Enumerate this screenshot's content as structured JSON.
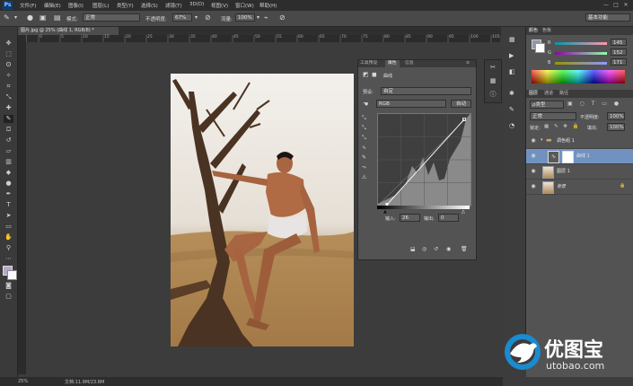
{
  "app": {
    "logo": "Ps",
    "workspace": "基本功能"
  },
  "menu": [
    "文件(F)",
    "编辑(E)",
    "图像(I)",
    "图层(L)",
    "类型(Y)",
    "选择(S)",
    "滤镜(T)",
    "3D(D)",
    "视图(V)",
    "窗口(W)",
    "帮助(H)"
  ],
  "window_controls": [
    "—",
    "□",
    "✕"
  ],
  "options": {
    "mode_label": "模式:",
    "mode_value": "正常",
    "opacity_label": "不透明度:",
    "opacity_value": "67%",
    "flow_label": "流量:",
    "flow_value": "100%"
  },
  "document": {
    "tab_title": "图片.jpg @ 25% (曲线 1, RGB/8) *",
    "zoom": "25%",
    "doc_info": "文档:11.9M/23.8M",
    "ruler_ticks": [
      "0",
      "5",
      "10",
      "15",
      "20",
      "25",
      "30",
      "35",
      "40",
      "45",
      "50",
      "55",
      "60",
      "65",
      "70",
      "75",
      "80",
      "85",
      "90",
      "95",
      "100",
      "105"
    ]
  },
  "properties": {
    "tabs": [
      "工具预设",
      "属性",
      "信息"
    ],
    "title": "曲线",
    "preset_label": "预设:",
    "preset_value": "自定",
    "channel_value": "RGB",
    "auto_button": "自动",
    "input_label": "输入:",
    "input_value": "26",
    "output_label": "输出:",
    "output_value": "0"
  },
  "color_panel": {
    "tabs": [
      "颜色",
      "色板"
    ],
    "r_label": "R",
    "r_value": "145",
    "g_label": "G",
    "g_value": "152",
    "b_label": "B",
    "b_value": "171"
  },
  "layers_panel": {
    "tabs": [
      "图层",
      "通道",
      "路径"
    ],
    "filter_value": "ρ类型",
    "blend_value": "正常",
    "opacity_label": "不透明度:",
    "opacity_value": "100%",
    "lock_label": "锁定:",
    "fill_label": "填充:",
    "fill_value": "100%",
    "layers": [
      {
        "name": "调色组 1",
        "type": "group"
      },
      {
        "name": "曲线 1",
        "type": "adjustment"
      },
      {
        "name": "图层 1",
        "type": "pixel"
      },
      {
        "name": "背景",
        "type": "background"
      }
    ]
  },
  "watermark": {
    "brand": "优图宝",
    "url": "utobao.com"
  }
}
